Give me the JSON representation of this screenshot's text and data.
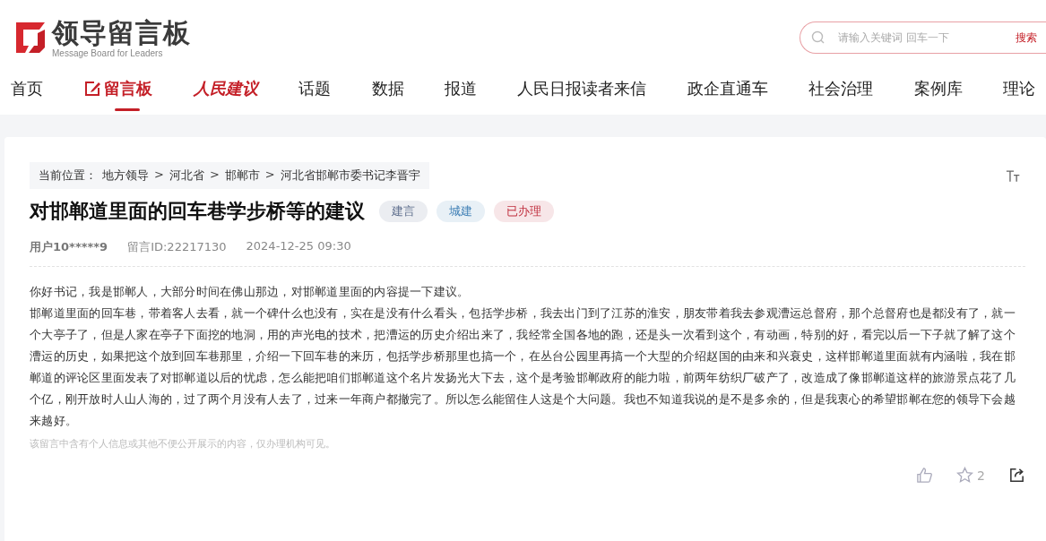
{
  "logo": {
    "title": "领导留言板",
    "subtitle": "Message Board for Leaders"
  },
  "search": {
    "placeholder": "请输入关键词 回车一下",
    "button": "搜索"
  },
  "nav": [
    {
      "label": "首页",
      "kind": "text",
      "selected": false
    },
    {
      "label": "留言板",
      "kind": "icon",
      "selected": true
    },
    {
      "label": "人民建议",
      "kind": "brand",
      "selected": false
    },
    {
      "label": "话题",
      "kind": "text",
      "selected": false
    },
    {
      "label": "数据",
      "kind": "text",
      "selected": false
    },
    {
      "label": "报道",
      "kind": "text",
      "selected": false
    },
    {
      "label": "人民日报读者来信",
      "kind": "text",
      "selected": false
    },
    {
      "label": "政企直通车",
      "kind": "text",
      "selected": false
    },
    {
      "label": "社会治理",
      "kind": "text",
      "selected": false
    },
    {
      "label": "案例库",
      "kind": "text",
      "selected": false
    },
    {
      "label": "理论",
      "kind": "text",
      "selected": false
    }
  ],
  "breadcrumb": {
    "prefix": "当前位置：",
    "items": [
      "地方领导",
      "河北省",
      "邯郸市",
      "河北省邯郸市委书记李晋宇"
    ],
    "separator": ">"
  },
  "title": "对邯郸道里面的回车巷学步桥等的建议",
  "tags": [
    {
      "label": "建言",
      "color": "#5a6b8a"
    },
    {
      "label": "城建",
      "color": "#3f7fb5"
    },
    {
      "label": "已办理",
      "color": "#c0303f"
    }
  ],
  "meta": {
    "user": "用户10*****9",
    "id": "留言ID:22217130",
    "time": "2024-12-25 09:30"
  },
  "paragraphs": [
    "你好书记，我是邯郸人，大部分时间在佛山那边，对邯郸道里面的内容提一下建议。",
    "邯郸道里面的回车巷，带着客人去看，就一个碑什么也没有，实在是没有什么看头，包括学步桥，我去出门到了江苏的淮安，朋友带着我去参观漕运总督府，那个总督府也是都没有了，就一个大亭子了，但是人家在亭子下面挖的地洞，用的声光电的技术，把漕运的历史介绍出来了，我经常全国各地的跑，还是头一次看到这个，有动画，特别的好，看完以后一下子就了解了这个漕运的历史，如果把这个放到回车巷那里，介绍一下回车巷的来历，包括学步桥那里也搞一个，在丛台公园里再搞一个大型的介绍赵国的由来和兴衰史，这样邯郸道里面就有内涵啦，我在邯郸道的评论区里面发表了对邯郸道以后的忧虑，怎么能把咱们邯郸道这个名片发扬光大下去，这个是考验邯郸政府的能力啦，前两年纺织厂破产了，改造成了像邯郸道这样的旅游景点花了几个亿，刚开放时人山人海的，过了两个月没有人去了，过来一年商户都撤完了。所以怎么能留住人这是个大问题。我也不知道我说的是不是多余的，但是我衷心的希望邯郸在您的领导下会越来越好。"
  ],
  "notice": "该留言中含有个人信息或其他不便公开展示的内容，仅办理机构可见。",
  "actions": {
    "favorites": "2"
  }
}
